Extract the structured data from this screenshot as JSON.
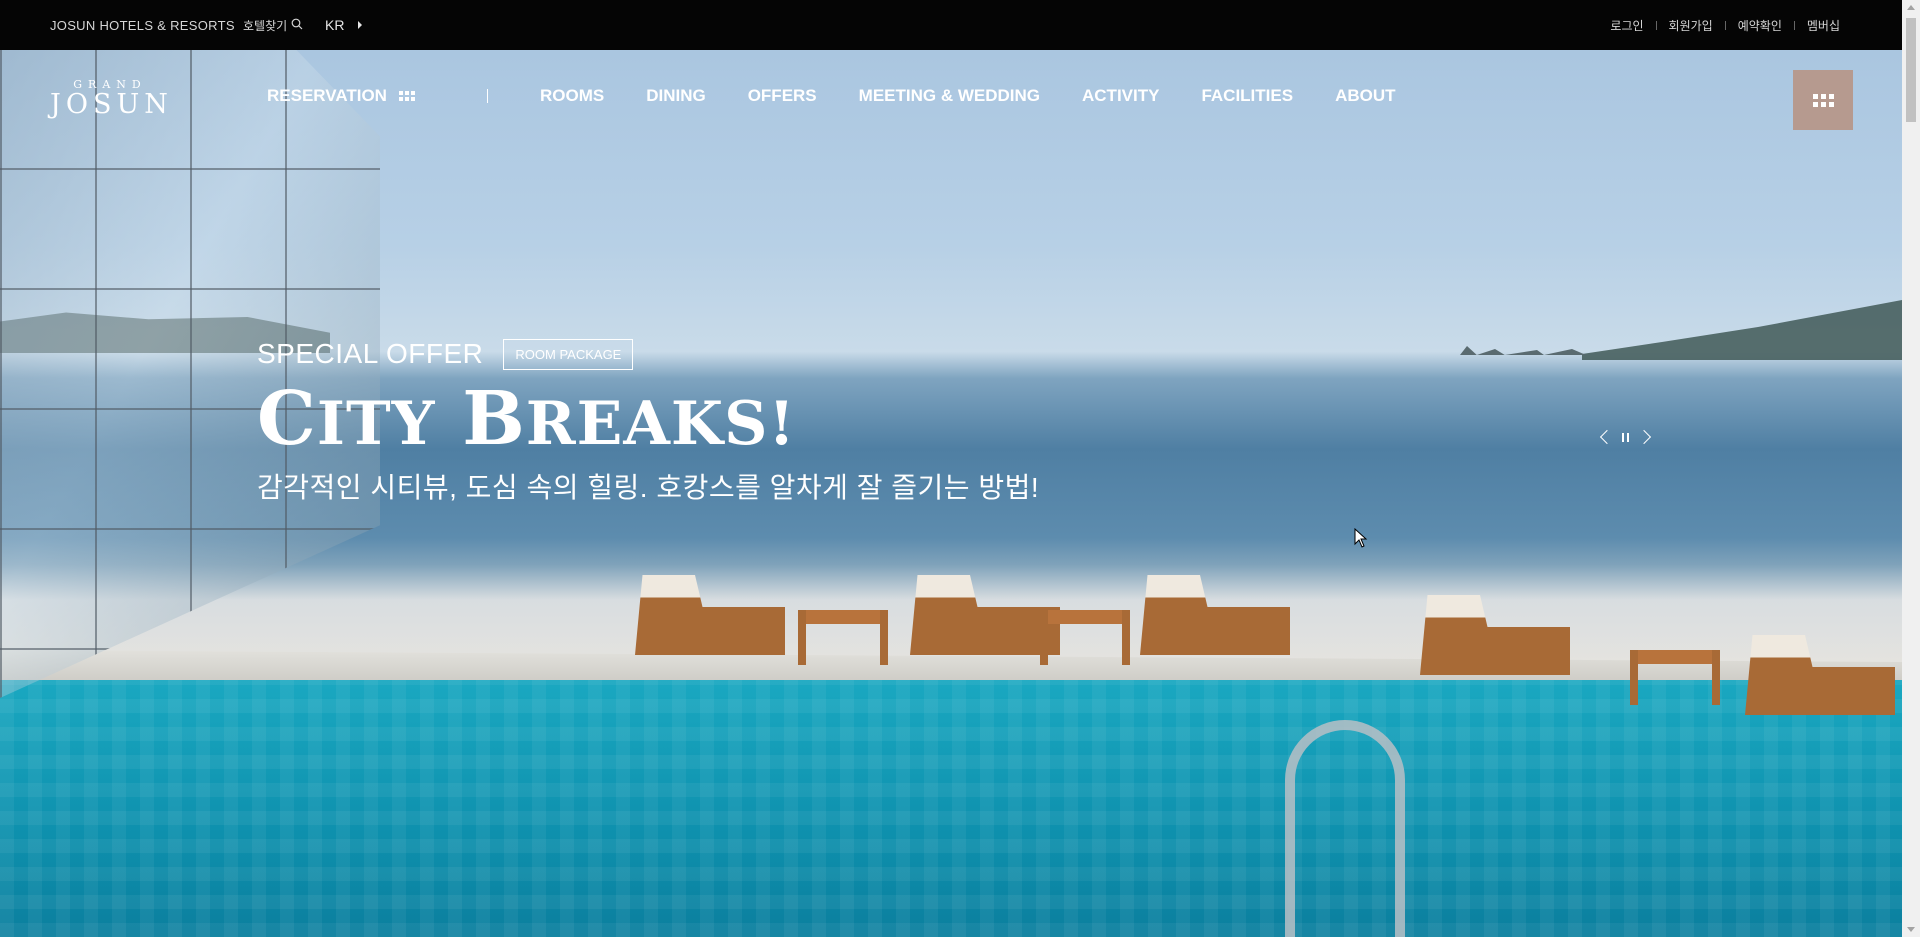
{
  "topbar": {
    "brand": "JOSUN HOTELS & RESORTS",
    "find_hotel": "호텔찾기",
    "language": "KR",
    "util_links": [
      "로그인",
      "회원가입",
      "예약확인",
      "멤버십"
    ]
  },
  "logo": {
    "line1": "GRAND",
    "line2": "JOSUN"
  },
  "nav": {
    "reservation": "RESERVATION",
    "items": [
      "ROOMS",
      "DINING",
      "OFFERS",
      "MEETING & WEDDING",
      "ACTIVITY",
      "FACILITIES",
      "ABOUT"
    ]
  },
  "hero": {
    "eyebrow": "SPECIAL OFFER",
    "tag": "ROOM PACKAGE",
    "headline_c": "C",
    "headline_ity": "ITY",
    "headline_b": "B",
    "headline_reaks": "REAKS!",
    "subtitle": "감각적인 시티뷰, 도심 속의 힐링. 호캉스를 알차게 잘 즐기는 방법!"
  },
  "icons": {
    "search": "search-icon",
    "menu": "grid-menu-icon",
    "reservation": "grid-dots-icon",
    "slider_prev": "chevron-left-icon",
    "slider_pause": "pause-icon",
    "slider_next": "chevron-right-icon"
  },
  "colors": {
    "topbar_bg": "#050505",
    "menu_button": "#b69a8f",
    "text_light": "#ffffff"
  }
}
